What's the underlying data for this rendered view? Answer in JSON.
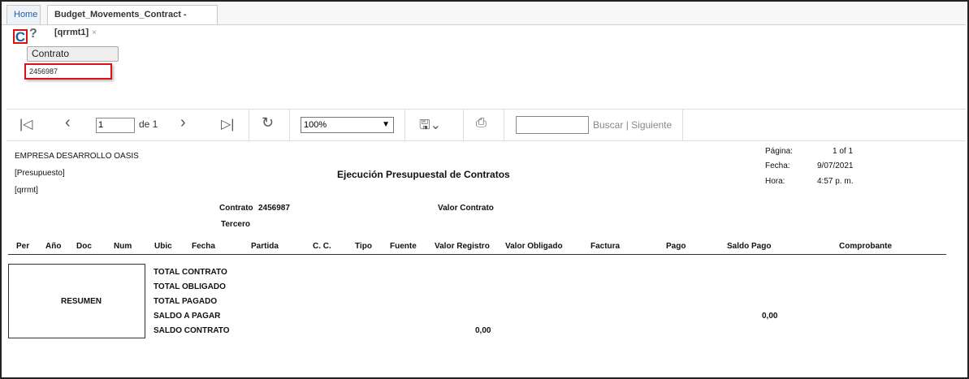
{
  "tabs": {
    "home": "Home",
    "active": "Budget_Movements_Contract -[qrrmt1]",
    "close": "×"
  },
  "params": {
    "refresh_icon": "C",
    "help_icon": "?",
    "label": "Contrato",
    "value": "2456987"
  },
  "toolbar": {
    "page": "1",
    "of_label": "de 1",
    "zoom": "100%",
    "search_label": "Buscar",
    "next_label": "| Siguiente"
  },
  "report": {
    "company": "EMPRESA DESARROLLO OASIS",
    "budget_tag": "[Presupuesto]",
    "code_tag": "[qrrmt]",
    "title": "Ejecución Presupuestal de Contratos",
    "meta": {
      "page_label": "Página:",
      "page_value": "1 of 1",
      "date_label": "Fecha:",
      "date_value": "9/07/2021",
      "time_label": "Hora:",
      "time_value": "4:57 p. m."
    },
    "contract_label": "Contrato",
    "contract_value": "2456987",
    "value_label": "Valor Contrato",
    "third_label": "Tercero",
    "columns": [
      "Per",
      "Año",
      "Doc",
      "Num",
      "Ubic",
      "Fecha",
      "Partida",
      "C. C.",
      "Tipo",
      "Fuente",
      "Valor Registro",
      "Valor Obligado",
      "Factura",
      "Pago",
      "Saldo Pago",
      "Comprobante"
    ],
    "summary_label": "RESUMEN",
    "totals": [
      "TOTAL CONTRATO",
      "TOTAL OBLIGADO",
      "TOTAL PAGADO",
      "SALDO A PAGAR",
      "SALDO CONTRATO"
    ],
    "saldo_pagar_value": "0,00",
    "saldo_contrato_value": "0,00"
  }
}
